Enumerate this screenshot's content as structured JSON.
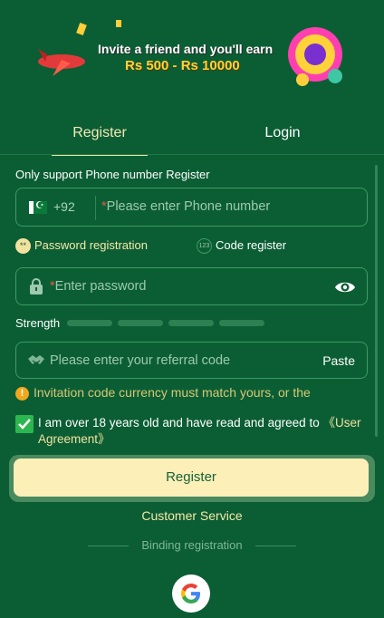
{
  "banner": {
    "line1": "Invite a friend and you'll earn",
    "line2": "Rs 500 - Rs 10000"
  },
  "tabs": {
    "register": "Register",
    "login": "Login"
  },
  "form": {
    "support_hint": "Only support Phone number Register",
    "phone": {
      "country_code": "+92",
      "required_mark": "*",
      "placeholder": "Please enter Phone number"
    },
    "options": {
      "password_registration": "Password registration",
      "code_register": "Code register",
      "code_icon_text": "123"
    },
    "password": {
      "required_mark": "*",
      "placeholder": "Enter password"
    },
    "strength": {
      "label": "Strength",
      "level": 0,
      "segments": 4
    },
    "referral": {
      "placeholder": "Please enter your referral code",
      "paste_label": "Paste"
    },
    "warning": "Invitation code currency must match yours, or the",
    "agreement": {
      "checked": true,
      "text": "I am over 18 years old and have read and agreed to ",
      "link": "《User Agreement》"
    },
    "register_button": "Register"
  },
  "footer": {
    "customer_service": "Customer Service",
    "binding_registration": "Binding registration"
  },
  "colors": {
    "background": "#0b5e34",
    "accent": "#f3e1a0",
    "button": "#fdefb8",
    "checkbox": "#2db64f",
    "warning": "#f2a81d"
  }
}
